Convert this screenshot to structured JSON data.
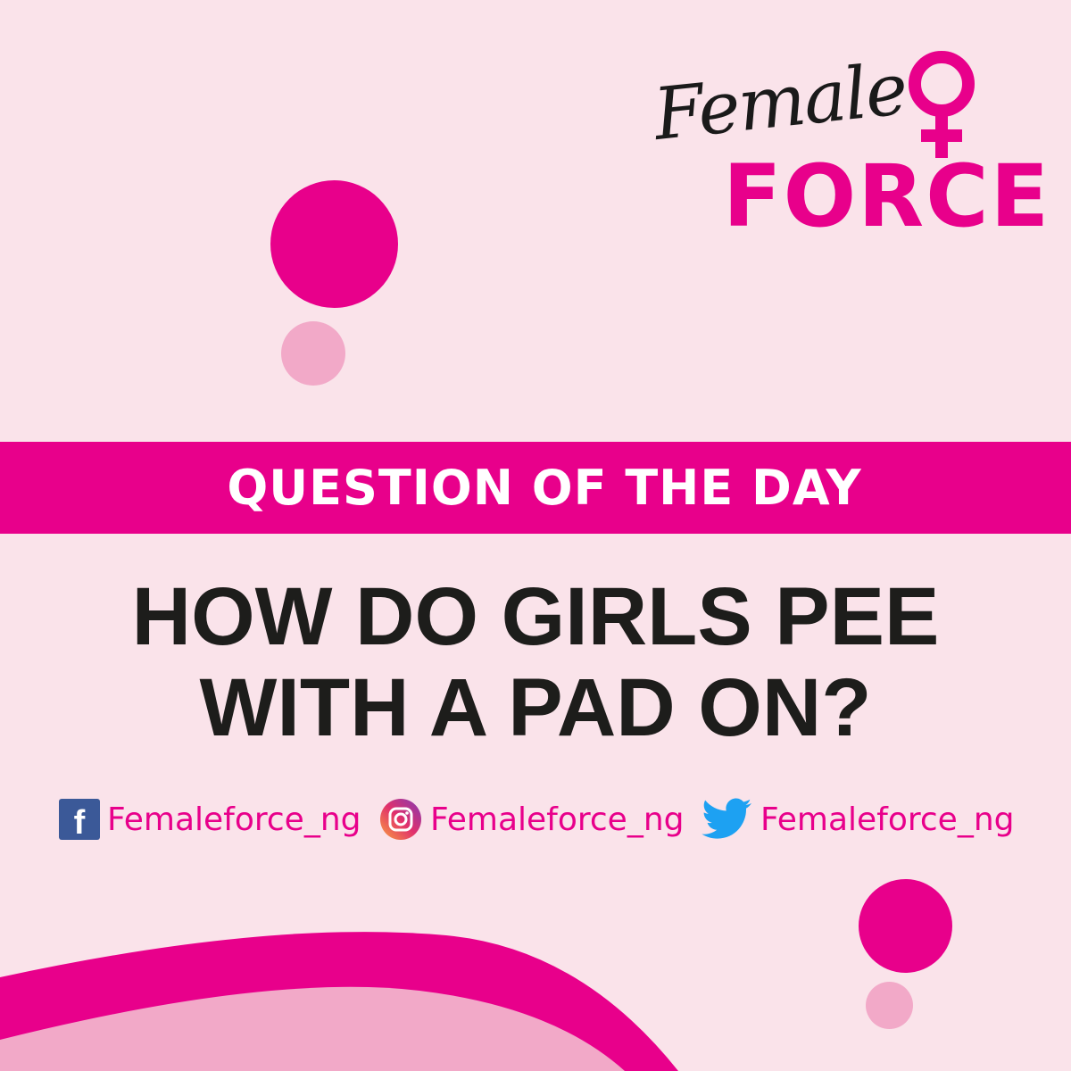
{
  "brand": {
    "script": "Female",
    "word": "FORCE"
  },
  "banner": {
    "label": "QUESTION OF THE DAY"
  },
  "question": {
    "line1": "HOW DO GIRLS PEE",
    "line2": "WITH A PAD ON?"
  },
  "socials": [
    {
      "icon": "facebook-icon",
      "handle": "Femaleforce_ng"
    },
    {
      "icon": "instagram-icon",
      "handle": "Femaleforce_ng"
    },
    {
      "icon": "twitter-icon",
      "handle": "Femaleforce_ng"
    }
  ],
  "colors": {
    "background": "#fae3ea",
    "accent": "#e8008b",
    "accent_light": "#f2a9c8",
    "text_dark": "#1d1d1b"
  }
}
